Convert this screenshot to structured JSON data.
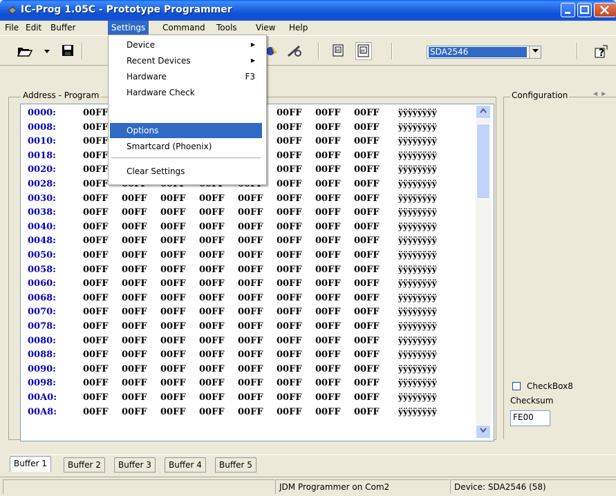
{
  "window": {
    "title": "IC-Prog 1.05C - Prototype Programmer"
  },
  "menu": [
    "File",
    "Edit",
    "Buffer",
    "Settings",
    "Command",
    "Tools",
    "View",
    "Help"
  ],
  "settings_menu": {
    "items": [
      {
        "label": "Device",
        "submenu": true
      },
      {
        "label": "Recent Devices",
        "submenu": true
      },
      {
        "label": "Hardware",
        "shortcut": "F3"
      },
      {
        "label": "Hardware Check"
      },
      {
        "label": "Options",
        "highlighted": true
      },
      {
        "label": "Smartcard (Phoenix)"
      },
      {
        "label": "Clear Settings"
      }
    ]
  },
  "toolbar": {
    "device_select": "SDA2546"
  },
  "address_group": {
    "label": "Address - Program"
  },
  "hex_rows": [
    {
      "addr": "0000:",
      "ascii": "ÿÿÿÿÿÿÿÿ"
    },
    {
      "addr": "0008:",
      "ascii": "ÿÿÿÿÿÿÿÿ"
    },
    {
      "addr": "0010:",
      "ascii": "ÿÿÿÿÿÿÿÿ"
    },
    {
      "addr": "0018:",
      "ascii": "ÿÿÿÿÿÿÿÿ"
    },
    {
      "addr": "0020:",
      "ascii": "ÿÿÿÿÿÿÿÿ"
    },
    {
      "addr": "0028:",
      "ascii": "ÿÿÿÿÿÿÿÿ"
    },
    {
      "addr": "0030:",
      "ascii": "ÿÿÿÿÿÿÿÿ"
    },
    {
      "addr": "0038:",
      "ascii": "ÿÿÿÿÿÿÿÿ"
    },
    {
      "addr": "0040:",
      "ascii": "ÿÿÿÿÿÿÿÿ"
    },
    {
      "addr": "0048:",
      "ascii": "ÿÿÿÿÿÿÿÿ"
    },
    {
      "addr": "0050:",
      "ascii": "ÿÿÿÿÿÿÿÿ"
    },
    {
      "addr": "0058:",
      "ascii": "ÿÿÿÿÿÿÿÿ"
    },
    {
      "addr": "0060:",
      "ascii": "ÿÿÿÿÿÿÿÿ"
    },
    {
      "addr": "0068:",
      "ascii": "ÿÿÿÿÿÿÿÿ"
    },
    {
      "addr": "0070:",
      "ascii": "ÿÿÿÿÿÿÿÿ"
    },
    {
      "addr": "0078:",
      "ascii": "ÿÿÿÿÿÿÿÿ"
    },
    {
      "addr": "0080:",
      "ascii": "ÿÿÿÿÿÿÿÿ"
    },
    {
      "addr": "0088:",
      "ascii": "ÿÿÿÿÿÿÿÿ"
    },
    {
      "addr": "0090:",
      "ascii": "ÿÿÿÿÿÿÿÿ"
    },
    {
      "addr": "0098:",
      "ascii": "ÿÿÿÿÿÿÿÿ"
    },
    {
      "addr": "00A0:",
      "ascii": "ÿÿÿÿÿÿÿÿ"
    },
    {
      "addr": "00A8:",
      "ascii": "ÿÿÿÿÿÿÿÿ"
    }
  ],
  "hex_value": "00FF",
  "config": {
    "label": "Configuration",
    "checkbox_label": "CheckBox8",
    "checksum_label": "Checksum",
    "checksum_value": "FE00"
  },
  "tabs": [
    "Buffer 1",
    "Buffer 2",
    "Buffer 3",
    "Buffer 4",
    "Buffer 5"
  ],
  "status": {
    "programmer": "JDM Programmer on Com2",
    "device": "Device: SDA2546  (58)"
  },
  "colors": {
    "title_blue": "#1f63e0",
    "highlight": "#316ac5",
    "address_blue": "#0000c0"
  }
}
